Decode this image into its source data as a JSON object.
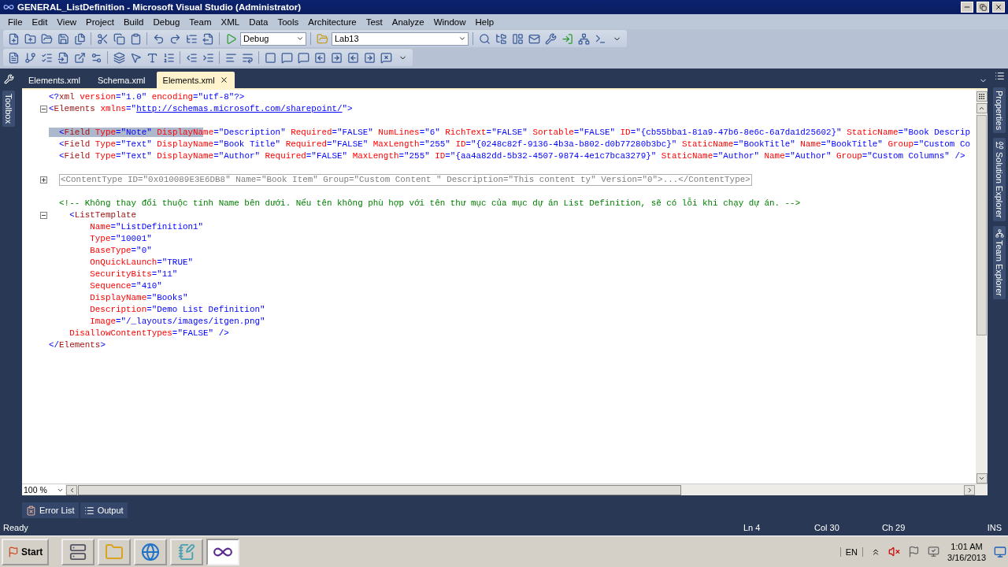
{
  "window": {
    "title": "GENERAL_ListDefinition - Microsoft Visual Studio (Administrator)"
  },
  "menu": [
    "File",
    "Edit",
    "View",
    "Project",
    "Build",
    "Debug",
    "Team",
    "XML",
    "Data",
    "Tools",
    "Architecture",
    "Test",
    "Analyze",
    "Window",
    "Help"
  ],
  "toolbar": {
    "configuration": "Debug",
    "startup_project": "Lab13"
  },
  "side_tabs_left": [
    "Toolbox"
  ],
  "side_tabs_right": [
    "Properties",
    "Solution Explorer",
    "Team Explorer"
  ],
  "document_tabs": [
    {
      "label": "Elements.xml",
      "selected": false
    },
    {
      "label": "Schema.xml",
      "selected": false
    },
    {
      "label": "Elements.xml",
      "selected": true
    }
  ],
  "editor": {
    "zoom": "100 %",
    "lines": [
      {
        "kind": "code",
        "segs": [
          {
            "kind": "delimiter",
            "text": "<?"
          },
          {
            "kind": "element",
            "text": "xml"
          },
          {
            "kind": "attribute",
            "text": " version"
          },
          {
            "kind": "value",
            "text": "=\"1.0\""
          },
          {
            "kind": "attribute",
            "text": " encoding"
          },
          {
            "kind": "value",
            "text": "=\"utf-8\""
          },
          {
            "kind": "delimiter",
            "text": "?>"
          }
        ]
      },
      {
        "kind": "code",
        "expanded": true,
        "segs": [
          {
            "kind": "delimiter",
            "text": "<"
          },
          {
            "kind": "element",
            "text": "Elements"
          },
          {
            "kind": "attribute",
            "text": " xmlns"
          },
          {
            "kind": "value",
            "text": "=\""
          },
          {
            "kind": "link",
            "text": "http://schemas.microsoft.com/sharepoint/"
          },
          {
            "kind": "value",
            "text": "\">"
          }
        ]
      },
      {
        "kind": "blank"
      },
      {
        "kind": "code",
        "segs": [
          {
            "kind": "delimiter",
            "text": "  <",
            "selected": true
          },
          {
            "kind": "element",
            "text": "Field",
            "selected": true
          },
          {
            "kind": "attribute",
            "text": " Type",
            "selected": true
          },
          {
            "kind": "value",
            "text": "=\"Note\"",
            "selected": true
          },
          {
            "kind": "attribute",
            "text": " DisplayNa",
            "selected": true
          },
          {
            "kind": "attribute",
            "text": "me",
            "selected": false
          },
          {
            "kind": "value",
            "text": "=\"Description\"",
            "selected": false
          },
          {
            "kind": "attribute",
            "text": " Required",
            "selected": false
          },
          {
            "kind": "value",
            "text": "=\"FALSE\"",
            "selected": false
          },
          {
            "kind": "attribute",
            "text": " NumLines",
            "selected": false
          },
          {
            "kind": "value",
            "text": "=\"6\"",
            "selected": false
          },
          {
            "kind": "attribute",
            "text": " RichText",
            "selected": false
          },
          {
            "kind": "value",
            "text": "=\"FALSE\"",
            "selected": false
          },
          {
            "kind": "attribute",
            "text": " Sortable",
            "selected": false
          },
          {
            "kind": "value",
            "text": "=\"FALSE\"",
            "selected": false
          },
          {
            "kind": "attribute",
            "text": " ID",
            "selected": false
          },
          {
            "kind": "value",
            "text": "=\"{cb55bba1-81a9-47b6-8e6c-6a7da1d25602}\"",
            "selected": false
          },
          {
            "kind": "attribute",
            "text": " StaticName",
            "selected": false
          },
          {
            "kind": "value",
            "text": "=\"Book Descrip",
            "selected": false
          }
        ]
      },
      {
        "kind": "code",
        "segs": [
          {
            "kind": "delimiter",
            "text": "  <"
          },
          {
            "kind": "element",
            "text": "Field"
          },
          {
            "kind": "attribute",
            "text": " Type"
          },
          {
            "kind": "value",
            "text": "=\"Text\""
          },
          {
            "kind": "attribute",
            "text": " DisplayName"
          },
          {
            "kind": "value",
            "text": "=\"Book Title\""
          },
          {
            "kind": "attribute",
            "text": " Required"
          },
          {
            "kind": "value",
            "text": "=\"FALSE\""
          },
          {
            "kind": "attribute",
            "text": " MaxLength"
          },
          {
            "kind": "value",
            "text": "=\"255\""
          },
          {
            "kind": "attribute",
            "text": " ID"
          },
          {
            "kind": "value",
            "text": "=\"{0248c82f-9136-4b3a-b802-d0b77280b3bc}\""
          },
          {
            "kind": "attribute",
            "text": " StaticName"
          },
          {
            "kind": "value",
            "text": "=\"BookTitle\""
          },
          {
            "kind": "attribute",
            "text": " Name"
          },
          {
            "kind": "value",
            "text": "=\"BookTitle\""
          },
          {
            "kind": "attribute",
            "text": " Group"
          },
          {
            "kind": "value",
            "text": "=\"Custom Co"
          }
        ]
      },
      {
        "kind": "code",
        "segs": [
          {
            "kind": "delimiter",
            "text": "  <"
          },
          {
            "kind": "element",
            "text": "Field"
          },
          {
            "kind": "attribute",
            "text": " Type"
          },
          {
            "kind": "value",
            "text": "=\"Text\""
          },
          {
            "kind": "attribute",
            "text": " DisplayName"
          },
          {
            "kind": "value",
            "text": "=\"Author\""
          },
          {
            "kind": "attribute",
            "text": " Required"
          },
          {
            "kind": "value",
            "text": "=\"FALSE\""
          },
          {
            "kind": "attribute",
            "text": " MaxLength"
          },
          {
            "kind": "value",
            "text": "=\"255\""
          },
          {
            "kind": "attribute",
            "text": " ID"
          },
          {
            "kind": "value",
            "text": "=\"{aa4a82dd-5b32-4507-9874-4e1c7bca3279}\""
          },
          {
            "kind": "attribute",
            "text": " StaticName"
          },
          {
            "kind": "value",
            "text": "=\"Author\""
          },
          {
            "kind": "attribute",
            "text": " Name"
          },
          {
            "kind": "value",
            "text": "=\"Author\""
          },
          {
            "kind": "attribute",
            "text": " Group"
          },
          {
            "kind": "value",
            "text": "=\"Custom Columns\""
          },
          {
            "kind": "delimiter",
            "text": " />"
          }
        ]
      },
      {
        "kind": "blank"
      },
      {
        "kind": "collapsed",
        "expanded": false,
        "text": "<ContentType ID=\"0x010089E3E6DB8\" Name=\"Book Item\" Group=\"Custom Content \" Description=\"This content ty\" Version=\"0\">...</ContentType>"
      },
      {
        "kind": "blank"
      },
      {
        "kind": "code",
        "segs": [
          {
            "kind": "comment",
            "text": "  <!-- Không thay đổi thuộc tính Name bên dưới. Nếu tên không phù hợp với tên thư mục của mục dự án List Definition, sẽ có lỗi khi chạy dự án. -->"
          }
        ]
      },
      {
        "kind": "code",
        "expanded": true,
        "segs": [
          {
            "kind": "delimiter",
            "text": "    <"
          },
          {
            "kind": "element",
            "text": "ListTemplate"
          }
        ]
      },
      {
        "kind": "code",
        "segs": [
          {
            "kind": "attribute",
            "text": "        Name"
          },
          {
            "kind": "value",
            "text": "=\"ListDefinition1\""
          }
        ]
      },
      {
        "kind": "code",
        "segs": [
          {
            "kind": "attribute",
            "text": "        Type"
          },
          {
            "kind": "value",
            "text": "=\"10001\""
          }
        ]
      },
      {
        "kind": "code",
        "segs": [
          {
            "kind": "attribute",
            "text": "        BaseType"
          },
          {
            "kind": "value",
            "text": "=\"0\""
          }
        ]
      },
      {
        "kind": "code",
        "segs": [
          {
            "kind": "attribute",
            "text": "        OnQuickLaunch"
          },
          {
            "kind": "value",
            "text": "=\"TRUE\""
          }
        ]
      },
      {
        "kind": "code",
        "segs": [
          {
            "kind": "attribute",
            "text": "        SecurityBits"
          },
          {
            "kind": "value",
            "text": "=\"11\""
          }
        ]
      },
      {
        "kind": "code",
        "segs": [
          {
            "kind": "attribute",
            "text": "        Sequence"
          },
          {
            "kind": "value",
            "text": "=\"410\""
          }
        ]
      },
      {
        "kind": "code",
        "segs": [
          {
            "kind": "attribute",
            "text": "        DisplayName"
          },
          {
            "kind": "value",
            "text": "=\"Books\""
          }
        ]
      },
      {
        "kind": "code",
        "segs": [
          {
            "kind": "attribute",
            "text": "        Description"
          },
          {
            "kind": "value",
            "text": "=\"Demo List Definition\""
          }
        ]
      },
      {
        "kind": "code",
        "segs": [
          {
            "kind": "attribute",
            "text": "        Image"
          },
          {
            "kind": "value",
            "text": "=\"/_layouts/images/itgen.png\""
          }
        ]
      },
      {
        "kind": "code",
        "segs": [
          {
            "kind": "attribute",
            "text": "    DisallowContentTypes"
          },
          {
            "kind": "value",
            "text": "=\"FALSE\""
          },
          {
            "kind": "delimiter",
            "text": " />"
          }
        ]
      },
      {
        "kind": "code",
        "segs": [
          {
            "kind": "delimiter",
            "text": "</"
          },
          {
            "kind": "element",
            "text": "Elements"
          },
          {
            "kind": "delimiter",
            "text": ">"
          }
        ]
      }
    ]
  },
  "tool_windows": [
    "Error List",
    "Output"
  ],
  "status_bar": {
    "message": "Ready",
    "line": "Ln 4",
    "column": "Col 30",
    "char": "Ch 29",
    "mode": "INS"
  },
  "taskbar": {
    "start": "Start",
    "language": "EN",
    "time": "1:01 AM",
    "date": "3/16/2013"
  }
}
